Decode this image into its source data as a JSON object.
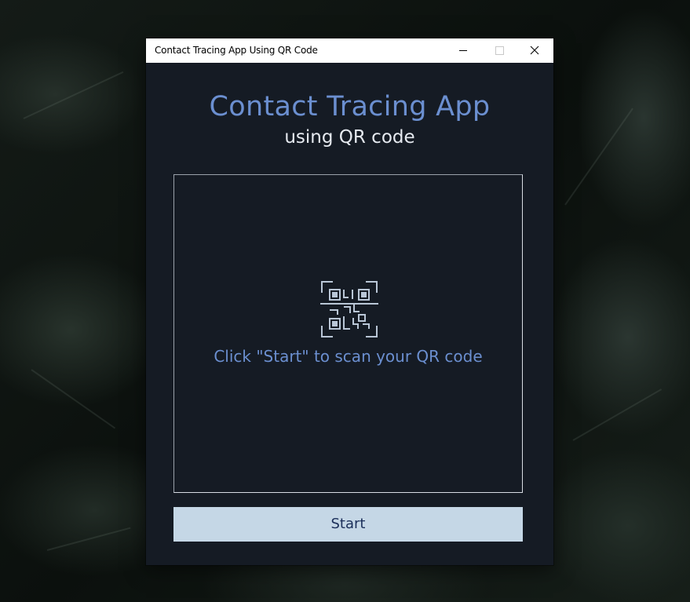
{
  "window": {
    "title": "Contact Tracing App Using QR Code",
    "controls": {
      "minimize_icon": "minimize-icon",
      "maximize_icon": "maximize-icon",
      "close_icon": "close-icon"
    }
  },
  "header": {
    "title": "Contact Tracing App",
    "subtitle": "using QR code"
  },
  "scanner": {
    "icon": "qr-code-scan-icon",
    "hint": "Click \"Start\" to scan your QR code"
  },
  "actions": {
    "start_label": "Start"
  },
  "colors": {
    "window_bg": "#151b24",
    "title_accent": "#6b8fd0",
    "subtitle": "#e6eaf0",
    "button_bg": "#c5d7e6",
    "button_text": "#1b2f5a"
  }
}
